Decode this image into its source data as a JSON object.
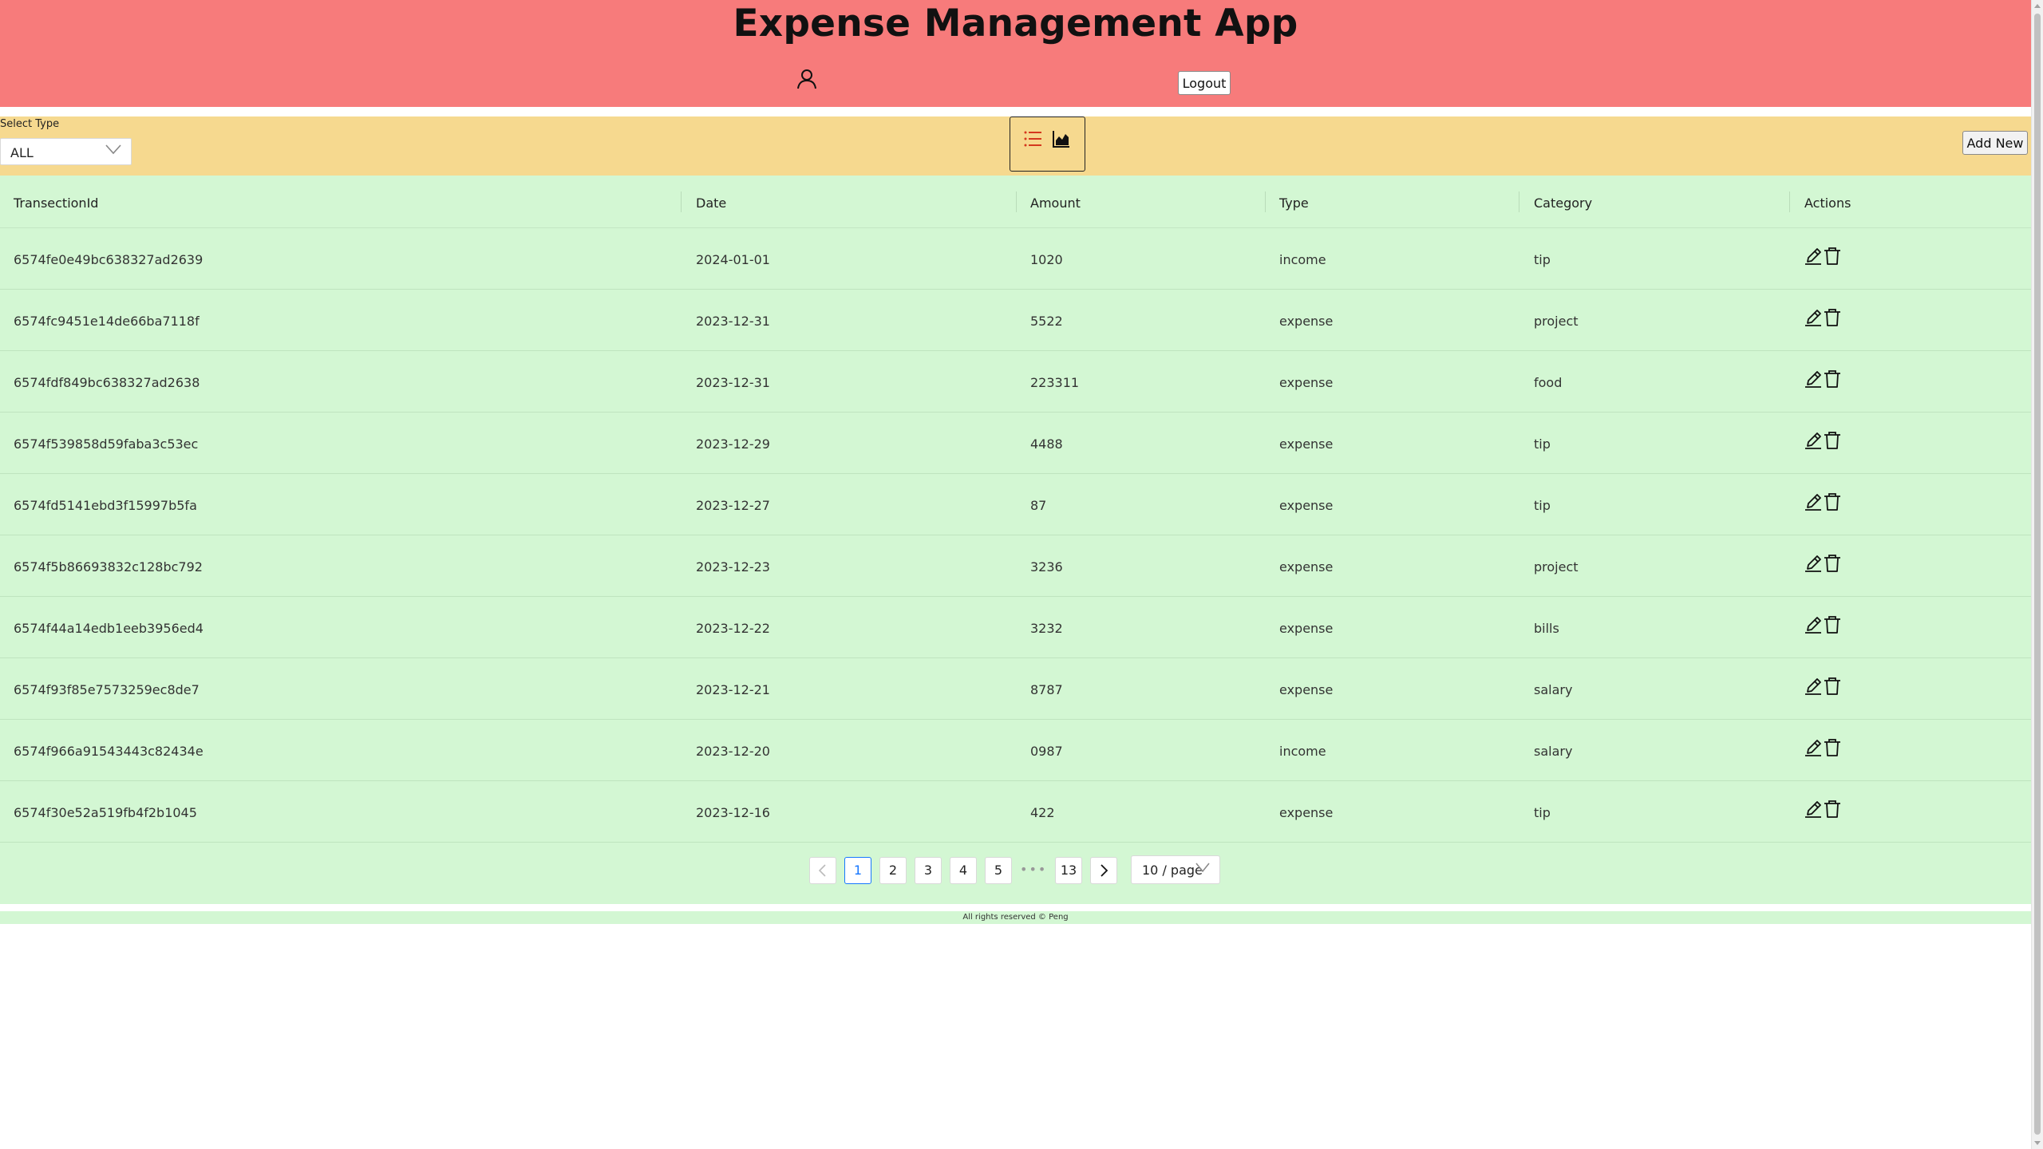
{
  "header": {
    "title": "Expense Management App",
    "logout_label": "Logout",
    "background_color": "#f77b7b"
  },
  "toolbar": {
    "select_label": "Select Type",
    "select_value": "ALL",
    "add_label": "Add New",
    "background_color": "#f6d98f",
    "active_view": "list"
  },
  "table": {
    "columns": [
      "TransectionId",
      "Date",
      "Amount",
      "Type",
      "Category",
      "Actions"
    ],
    "rows": [
      {
        "id": "6574fe0e49bc638327ad2639",
        "date": "2024-01-01",
        "amount": "1020",
        "type": "income",
        "category": "tip"
      },
      {
        "id": "6574fc9451e14de66ba7118f",
        "date": "2023-12-31",
        "amount": "5522",
        "type": "expense",
        "category": "project"
      },
      {
        "id": "6574fdf849bc638327ad2638",
        "date": "2023-12-31",
        "amount": "223311",
        "type": "expense",
        "category": "food"
      },
      {
        "id": "6574f539858d59faba3c53ec",
        "date": "2023-12-29",
        "amount": "4488",
        "type": "expense",
        "category": "tip"
      },
      {
        "id": "6574fd5141ebd3f15997b5fa",
        "date": "2023-12-27",
        "amount": "87",
        "type": "expense",
        "category": "tip"
      },
      {
        "id": "6574f5b86693832c128bc792",
        "date": "2023-12-23",
        "amount": "3236",
        "type": "expense",
        "category": "project"
      },
      {
        "id": "6574f44a14edb1eeb3956ed4",
        "date": "2023-12-22",
        "amount": "3232",
        "type": "expense",
        "category": "bills"
      },
      {
        "id": "6574f93f85e7573259ec8de7",
        "date": "2023-12-21",
        "amount": "8787",
        "type": "expense",
        "category": "salary"
      },
      {
        "id": "6574f966a91543443c82434e",
        "date": "2023-12-20",
        "amount": "0987",
        "type": "income",
        "category": "salary"
      },
      {
        "id": "6574f30e52a519fb4f2b1045",
        "date": "2023-12-16",
        "amount": "422",
        "type": "expense",
        "category": "tip"
      }
    ],
    "background_color": "#d3f7d3"
  },
  "pagination": {
    "pages": [
      "1",
      "2",
      "3",
      "4",
      "5"
    ],
    "ellipsis": "•••",
    "last_page": "13",
    "current": "1",
    "page_size": "10 / page"
  },
  "footer": {
    "text": "All rights reserved © Peng"
  }
}
